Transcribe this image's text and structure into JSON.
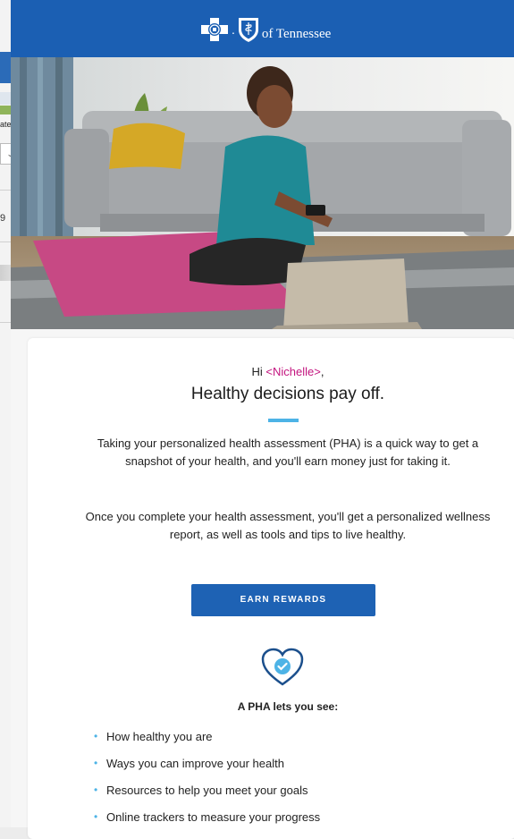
{
  "background_app": {
    "partial_text_1": "ate",
    "partial_text_2": "9"
  },
  "header": {
    "brand_text": "of Tennessee"
  },
  "greeting": {
    "hi": "Hi",
    "name": "<Nichelle>",
    "comma": ","
  },
  "headline": "Healthy decisions pay off.",
  "paragraphs": [
    "Taking your personalized health assessment (PHA) is a quick way to get a snapshot of your health, and you'll earn money just for taking it.",
    "Once you complete your health assessment, you'll get a personalized wellness report, as well as tools and tips to live healthy."
  ],
  "cta_label": "EARN REWARDS",
  "subheading": "A PHA lets you see:",
  "list_items": [
    "How healthy you are",
    "Ways you can improve your health",
    "Resources to help you meet your goals",
    "Online trackers to measure your progress"
  ],
  "icons": [
    "cross-logo-icon",
    "shield-logo-icon",
    "heart-check-icon"
  ],
  "colors": {
    "header_blue": "#1b5fb3",
    "accent": "#4db3e6",
    "name_magenta": "#c3157f",
    "button": "#1e62b4"
  }
}
